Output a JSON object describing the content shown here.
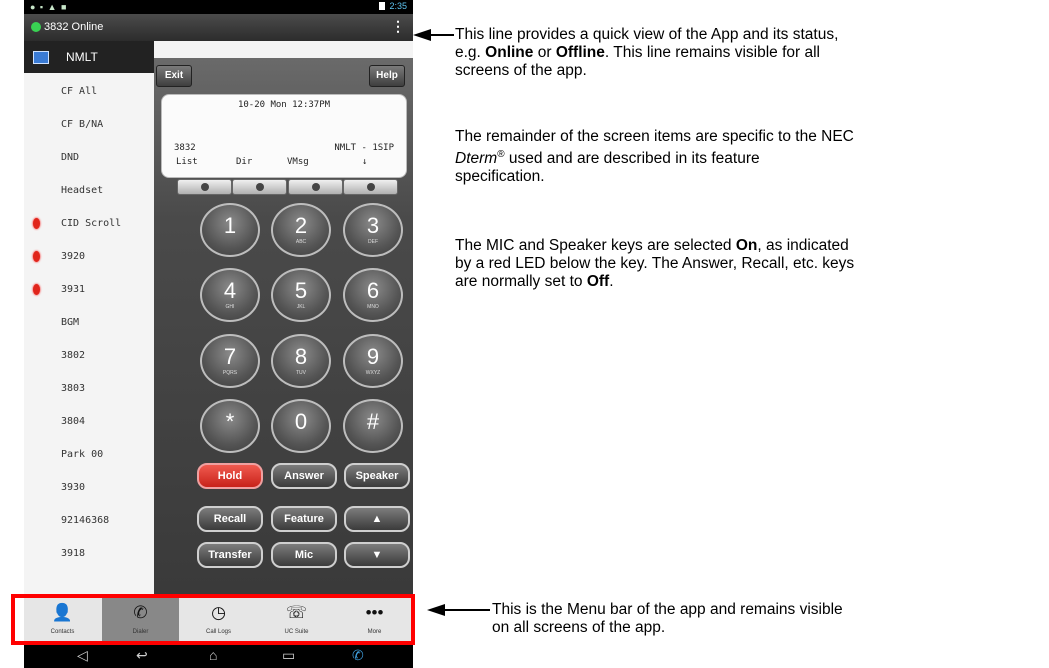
{
  "status_bar": {
    "left_icons": "● ▪ ▲ ■",
    "time": "2:35"
  },
  "app_status": {
    "text": "3832 Online",
    "menu_glyph": "⋮"
  },
  "header": {
    "label": "NMLT"
  },
  "key_list": [
    {
      "label": "CF All",
      "led": false
    },
    {
      "label": "CF B/NA",
      "led": false
    },
    {
      "label": "DND",
      "led": false
    },
    {
      "label": "Headset",
      "led": false
    },
    {
      "label": "CID Scroll",
      "led": true
    },
    {
      "label": "3920",
      "led": true
    },
    {
      "label": "3931",
      "led": true
    },
    {
      "label": "BGM",
      "led": false
    },
    {
      "label": "3802",
      "led": false
    },
    {
      "label": "3803",
      "led": false
    },
    {
      "label": "3804",
      "led": false
    },
    {
      "label": "Park 00",
      "led": false
    },
    {
      "label": "3930",
      "led": false
    },
    {
      "label": "92146368",
      "led": false
    },
    {
      "label": "3918",
      "led": false
    }
  ],
  "top_buttons": {
    "exit": "Exit",
    "help": "Help"
  },
  "lcd": {
    "datetime": "10-20 Mon 12:37PM",
    "extension": "3832",
    "name": "NMLT - 1SIP",
    "softkeys": [
      "List",
      "Dir",
      "VMsg",
      "↓"
    ]
  },
  "keypad": [
    {
      "num": "1",
      "sub": ""
    },
    {
      "num": "2",
      "sub": "ABC"
    },
    {
      "num": "3",
      "sub": "DEF"
    },
    {
      "num": "4",
      "sub": "GHI"
    },
    {
      "num": "5",
      "sub": "JKL"
    },
    {
      "num": "6",
      "sub": "MNO"
    },
    {
      "num": "7",
      "sub": "PQRS"
    },
    {
      "num": "8",
      "sub": "TUV"
    },
    {
      "num": "9",
      "sub": "WXYZ"
    },
    {
      "num": "*",
      "sub": ""
    },
    {
      "num": "0",
      "sub": ""
    },
    {
      "num": "#",
      "sub": ""
    }
  ],
  "function_keys": {
    "hold": "Hold",
    "answer": "Answer",
    "speaker": "Speaker",
    "recall": "Recall",
    "feature": "Feature",
    "up": "▲",
    "transfer": "Transfer",
    "mic": "Mic",
    "down": "▼"
  },
  "menu_bar": [
    {
      "label": "Contacts",
      "icon": "person-icon",
      "glyph": "👤"
    },
    {
      "label": "Dialer",
      "icon": "phone-handset-icon",
      "glyph": "✆"
    },
    {
      "label": "Call Logs",
      "icon": "clock-icon",
      "glyph": "◷"
    },
    {
      "label": "UC Suite",
      "icon": "uc-suite-icon",
      "glyph": "☏"
    },
    {
      "label": "More",
      "icon": "more-dots-icon",
      "glyph": "•••"
    }
  ],
  "android_nav": [
    "◁",
    "↩",
    "⌂",
    "▭",
    "✆"
  ],
  "annotations": {
    "status_1_a": "This line provides a quick view of the App and its status,",
    "status_1_b": "e.g. ",
    "status_online": "Online",
    "status_or": " or ",
    "status_offline": "Offline",
    "status_1_c": ". This line remains visible for all",
    "status_1_d": "screens of the app.",
    "dterm_a": "The remainder of the screen items are specific to the NEC",
    "dterm_word": "Dterm",
    "dterm_reg": "®",
    "dterm_b": " used and are described in its feature",
    "dterm_c": "specification.",
    "mic_a1": "The MIC and Speaker keys are selected ",
    "mic_on": "On",
    "mic_a2": ", as indicated",
    "mic_b": "by a red LED below the key. The Answer, Recall, etc. keys",
    "mic_c1": "are normally set to ",
    "mic_off": "Off",
    "mic_c2": ".",
    "menu_a": "This is the Menu bar of the app and remains visible",
    "menu_b": "on all screens of the app."
  },
  "colors": {
    "highlight": "#ff0000",
    "led": "#e0251b",
    "online": "#39d353",
    "hold": "#d8322a"
  }
}
